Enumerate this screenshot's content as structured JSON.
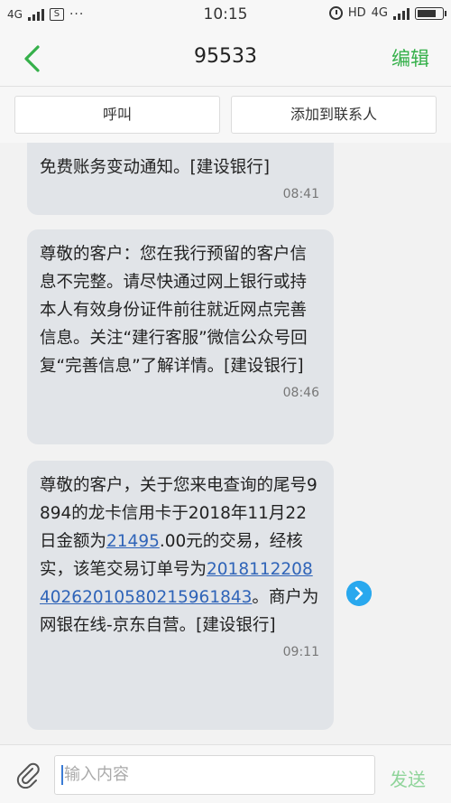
{
  "status_bar": {
    "network": "4G",
    "extra_box": "S",
    "dots": "···",
    "time": "10:15",
    "hd": "HD",
    "network_right": "4G"
  },
  "nav": {
    "title": "95533",
    "edit_label": "编辑"
  },
  "actions": {
    "call_label": "呼叫",
    "add_contact_label": "添加到联系人"
  },
  "messages": [
    {
      "text": "免费账务变动通知。[建设银行]",
      "time": "08:41"
    },
    {
      "text": "尊敬的客户：您在我行预留的客户信息不完整。请尽快通过网上银行或持本人有效身份证件前往就近网点完善信息。关注“建行客服”微信公众号回复“完善信息”了解详情。[建设银行]",
      "time": "08:46"
    },
    {
      "text_part1": "尊敬的客户，关于您来电查询的尾号9894的龙卡信用卡于2018年11月22日金额为",
      "amount_link": "21495",
      "text_part2": ".00元的交易，经核实，该笔交易订单号为",
      "order_link": "201811220840262010580215961843",
      "text_part3": "。商户为网银在线-京东自营。[建设银行]",
      "time": "09:11"
    }
  ],
  "input": {
    "placeholder": "输入内容",
    "send_label": "发送"
  },
  "colors": {
    "accent_green": "#35b04a",
    "link_blue": "#2f64b8",
    "bubble_bg": "#e1e4e8"
  }
}
